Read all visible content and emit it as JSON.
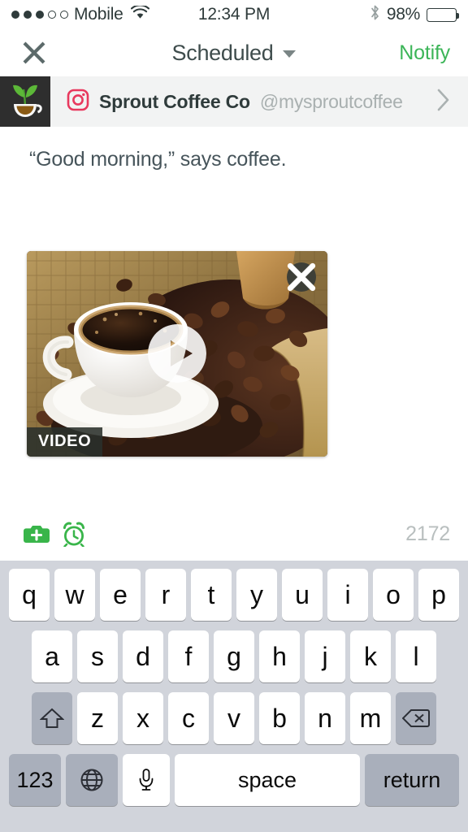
{
  "status_bar": {
    "carrier": "Mobile",
    "signal_dots_filled": 3,
    "signal_dots_total": 5,
    "wifi_icon": "wifi-icon",
    "time": "12:34 PM",
    "bluetooth_icon": "bluetooth-icon",
    "battery_percent": "98%",
    "battery_level": 98
  },
  "navbar": {
    "close_icon": "close-x-icon",
    "title": "Scheduled",
    "dropdown_icon": "chevron-down-icon",
    "action_label": "Notify",
    "action_color": "#3cb558"
  },
  "profile": {
    "avatar_name": "sprout-coffee-avatar",
    "network_icon": "instagram-icon",
    "network_color": "#e8395e",
    "name": "Sprout Coffee Co",
    "handle": "@mysproutcoffee",
    "chevron_icon": "chevron-right-icon"
  },
  "compose": {
    "text": "“Good morning,” says coffee."
  },
  "media": {
    "type": "video",
    "badge_label": "VIDEO",
    "remove_icon": "close-x-icon",
    "play_icon": "play-icon",
    "alt": "Cup of black coffee on a saucer beside roasted coffee beans spilling from a burlap sack"
  },
  "toolbar": {
    "add_media_icon": "camera-plus-icon",
    "schedule_icon": "alarm-clock-icon",
    "icon_color": "#3cb558",
    "character_count": "2172"
  },
  "keyboard": {
    "row1": [
      "q",
      "w",
      "e",
      "r",
      "t",
      "y",
      "u",
      "i",
      "o",
      "p"
    ],
    "row2": [
      "a",
      "s",
      "d",
      "f",
      "g",
      "h",
      "j",
      "k",
      "l"
    ],
    "row3": [
      "z",
      "x",
      "c",
      "v",
      "b",
      "n",
      "m"
    ],
    "shift_icon": "shift-arrow-icon",
    "backspace_icon": "backspace-icon",
    "numbers_label": "123",
    "globe_icon": "globe-icon",
    "mic_icon": "microphone-icon",
    "space_label": "space",
    "return_label": "return"
  }
}
